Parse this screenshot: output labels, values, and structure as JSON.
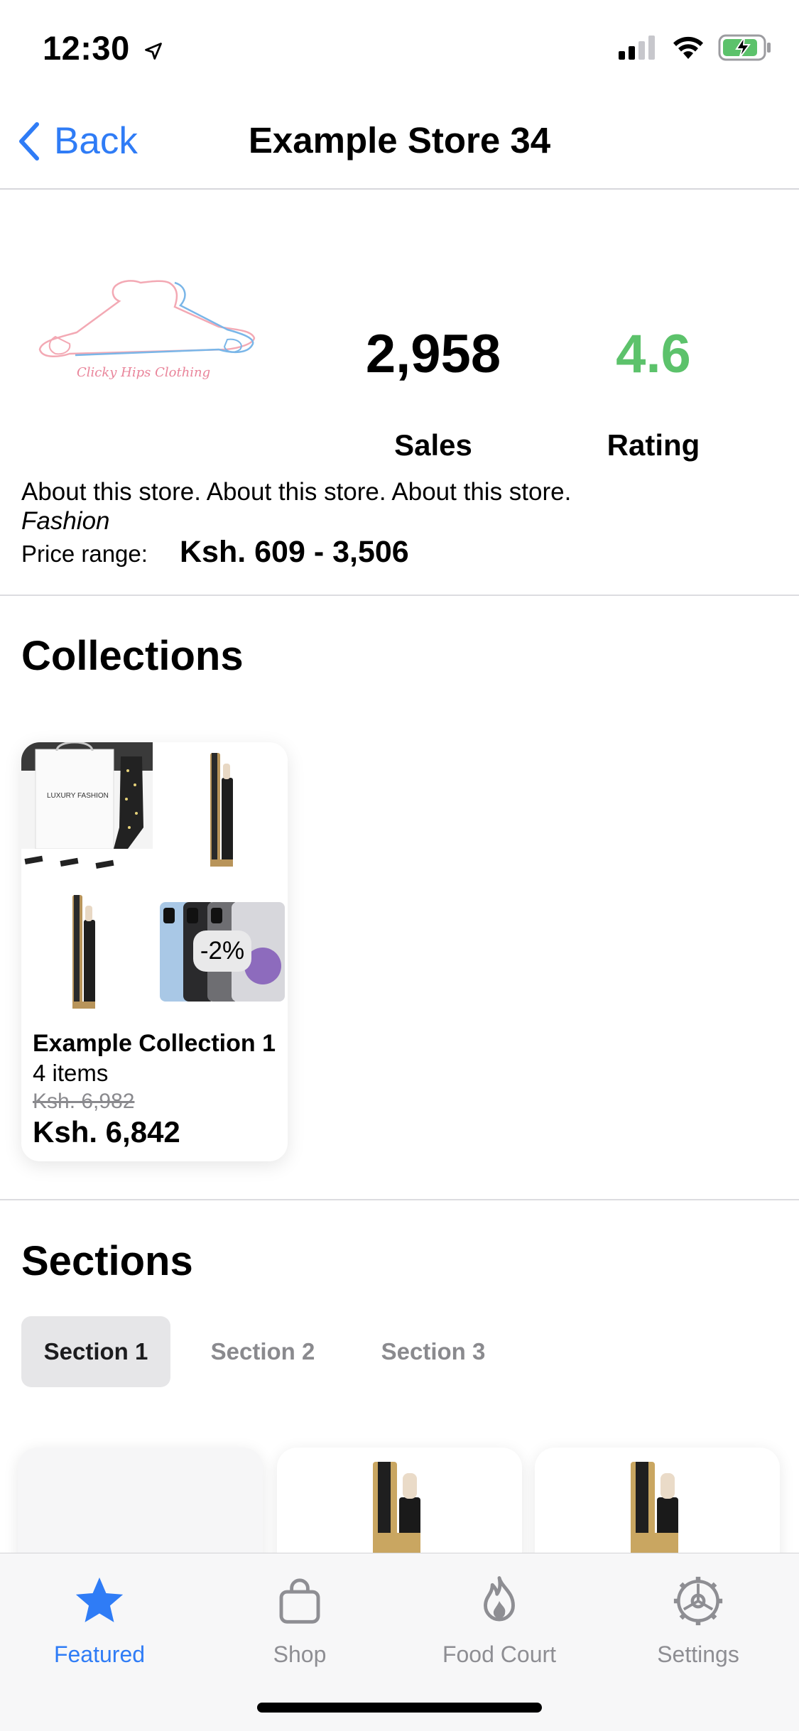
{
  "status_bar": {
    "time": "12:30"
  },
  "nav": {
    "back_label": "Back",
    "title": "Example Store 34"
  },
  "store": {
    "logo_text": "Clicky Hips Clothing",
    "sales_value": "2,958",
    "sales_label": "Sales",
    "rating_value": "4.6",
    "rating_label": "Rating",
    "about": "About this store. About this store. About this store.",
    "category": "Fashion",
    "price_range_label": "Price range:",
    "price_range_value": "Ksh. 609 - 3,506"
  },
  "collections": {
    "heading": "Collections",
    "items": [
      {
        "name": "Example Collection 1",
        "count": "4 items",
        "old_price": "Ksh. 6,982",
        "price": "Ksh. 6,842",
        "discount_badge": "-2%",
        "thumb_texts": [
          "LUXURY FASHION"
        ]
      }
    ]
  },
  "sections": {
    "heading": "Sections",
    "tabs": [
      "Section 1",
      "Section 2",
      "Section 3"
    ],
    "selected": "Section 1"
  },
  "tab_bar": {
    "items": [
      {
        "label": "Featured",
        "icon": "star-icon"
      },
      {
        "label": "Shop",
        "icon": "bag-icon"
      },
      {
        "label": "Food Court",
        "icon": "flame-icon"
      },
      {
        "label": "Settings",
        "icon": "gear-icon"
      }
    ],
    "active": "Featured"
  },
  "colors": {
    "accent": "#2f7cf6",
    "rating": "#5cc26b",
    "muted": "#8e8e93"
  }
}
